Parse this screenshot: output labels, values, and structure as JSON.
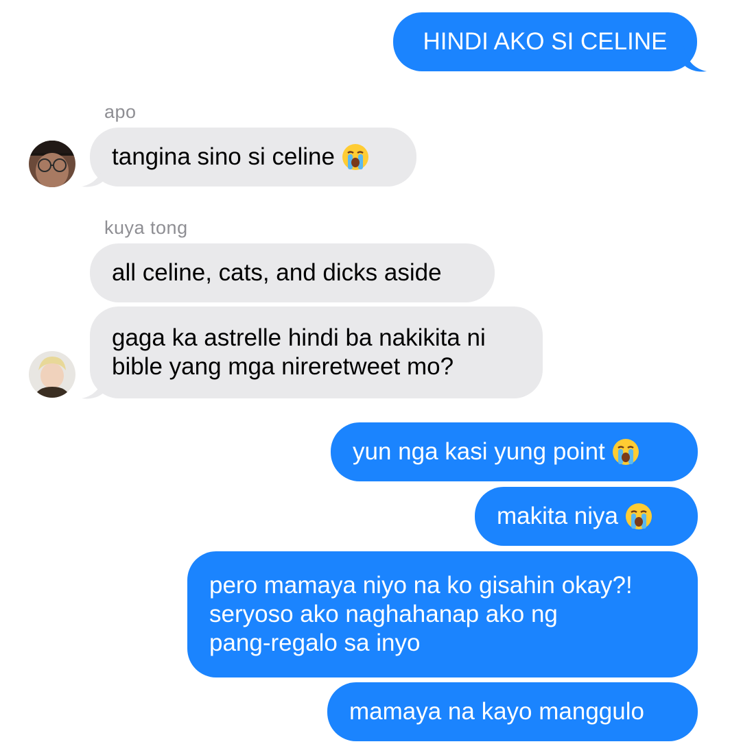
{
  "thread": {
    "messages": [
      {
        "id": "m1",
        "direction": "outgoing",
        "text": "HINDI AKO SI CELINE"
      },
      {
        "id": "m2",
        "direction": "incoming",
        "sender": "apo",
        "text": "tangina sino si celine",
        "emoji": "loudly-crying-face"
      },
      {
        "id": "m3",
        "direction": "incoming",
        "sender": "kuya tong",
        "text": "all celine, cats, and dicks aside"
      },
      {
        "id": "m4",
        "direction": "incoming",
        "lines": [
          "gaga ka astrelle hindi ba nakikita ni",
          "bible yang mga nireretweet mo?"
        ]
      },
      {
        "id": "m5",
        "direction": "outgoing",
        "text": "yun nga kasi yung point",
        "emoji": "loudly-crying-face"
      },
      {
        "id": "m6",
        "direction": "outgoing",
        "text": "makita niya",
        "emoji": "loudly-crying-face"
      },
      {
        "id": "m7",
        "direction": "outgoing",
        "lines": [
          "pero mamaya niyo na ko gisahin okay?!",
          "seryoso ako naghahanap ako ng",
          "pang-regalo sa inyo"
        ]
      },
      {
        "id": "m8",
        "direction": "outgoing",
        "text": "mamaya na kayo manggulo"
      }
    ]
  },
  "colors": {
    "outgoing_bubble": "#1b84fe",
    "incoming_bubble": "#e9e9eb",
    "sender_name": "#8e8e93"
  }
}
